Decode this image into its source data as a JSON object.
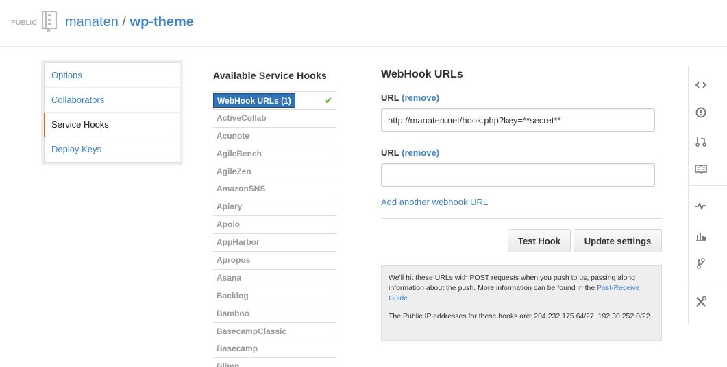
{
  "header": {
    "visibility": "PUBLIC",
    "owner": "manaten",
    "separator": "/",
    "repo": "wp-theme"
  },
  "settings_menu": {
    "items": [
      {
        "label": "Options"
      },
      {
        "label": "Collaborators"
      },
      {
        "label": "Service Hooks",
        "selected": true
      },
      {
        "label": "Deploy Keys"
      }
    ]
  },
  "hooks": {
    "title": "Available Service Hooks",
    "active_check": "✔",
    "items": [
      "WebHook URLs (1)",
      "ActiveCollab",
      "Acunote",
      "AgileBench",
      "AgileZen",
      "AmazonSNS",
      "Apiary",
      "Apoio",
      "AppHarbor",
      "Apropos",
      "Asana",
      "Backlog",
      "Bamboo",
      "BasecampClassic",
      "Basecamp",
      "Blimp"
    ]
  },
  "webhook": {
    "title": "WebHook URLs",
    "urls": [
      {
        "label": "URL",
        "remove": "(remove)",
        "value": "http://manaten.net/hook.php?key=**secret**"
      },
      {
        "label": "URL",
        "remove": "(remove)",
        "value": ""
      }
    ],
    "add_link": "Add another webhook URL",
    "test_button": "Test Hook",
    "update_button": "Update settings",
    "info_text_1": "We'll hit these URLs with POST requests when you push to us, passing along information about the push. More information can be found in the ",
    "info_link": "Post-Receive Guide",
    "info_text_1_end": ".",
    "info_text_2": "The Public IP addresses for these hooks are: 204.232.175.64/27, 192.30.252.0/22."
  },
  "colors": {
    "link": "#4183c4",
    "selected_accent": "#d26911",
    "active_hook_bg": "#3072b3",
    "check": "#6cc644"
  },
  "right_nav": {
    "icons": [
      "code-icon",
      "issues-icon",
      "pull-requests-icon",
      "wiki-icon",
      "pulse-icon",
      "graphs-icon",
      "network-icon",
      "settings-icon"
    ]
  }
}
